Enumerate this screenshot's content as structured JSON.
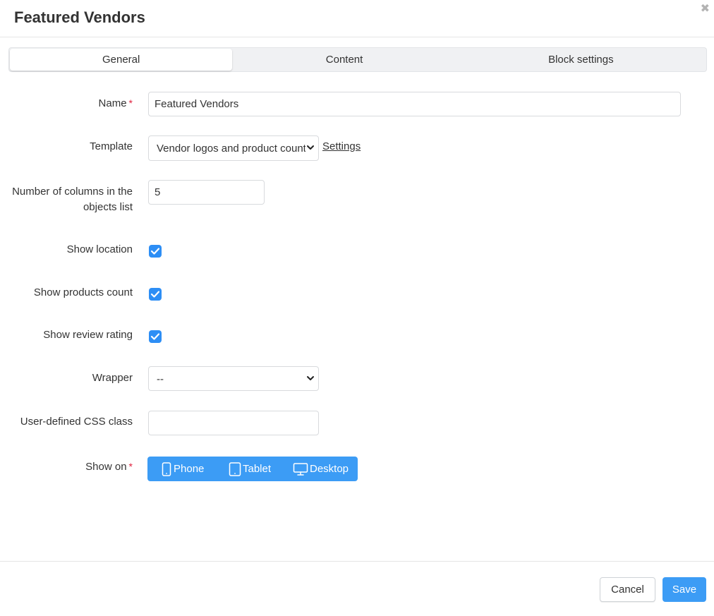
{
  "dialog": {
    "title": "Featured Vendors",
    "close_icon": "close-icon"
  },
  "tabs": [
    {
      "label": "General",
      "active": true
    },
    {
      "label": "Content",
      "active": false
    },
    {
      "label": "Block settings",
      "active": false
    }
  ],
  "form": {
    "name": {
      "label": "Name",
      "required_mark": "*",
      "value": "Featured Vendors"
    },
    "template": {
      "label": "Template",
      "selected": "Vendor logos and product count",
      "settings_link": "Settings"
    },
    "columns": {
      "label_line1": "Number of columns in the",
      "label_line2": "objects list",
      "value": "5"
    },
    "show_location": {
      "label": "Show location",
      "checked": true
    },
    "show_products_count": {
      "label": "Show products count",
      "checked": true
    },
    "show_review_rating": {
      "label": "Show review rating",
      "checked": true
    },
    "wrapper": {
      "label": "Wrapper",
      "selected": "--"
    },
    "css_class": {
      "label": "User-defined CSS class",
      "value": ""
    },
    "show_on": {
      "label": "Show on",
      "required_mark": "*",
      "options": [
        {
          "label": "Phone",
          "icon": "phone-icon"
        },
        {
          "label": "Tablet",
          "icon": "tablet-icon"
        },
        {
          "label": "Desktop",
          "icon": "desktop-icon"
        }
      ]
    }
  },
  "footer": {
    "cancel_label": "Cancel",
    "save_label": "Save"
  },
  "colors": {
    "accent": "#3c9cf5",
    "checkbox": "#2d8ef5",
    "required": "#e0223f"
  }
}
